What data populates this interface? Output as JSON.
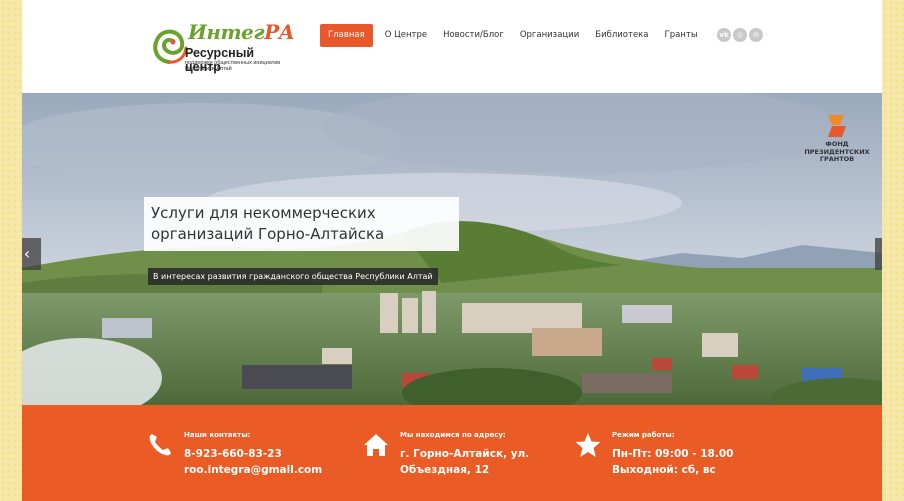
{
  "logo": {
    "script_part1": "Интег",
    "script_part2": "РА",
    "title": "Ресурсный центр",
    "subtitle": "поддержки общественных инициатив Республики Алтай"
  },
  "nav": {
    "items": [
      "Главная",
      "О Центре",
      "Новости/Блог",
      "Организации",
      "Библиотека",
      "Гранты"
    ]
  },
  "social": {
    "vk": "vk",
    "instagram": "◎",
    "email": "✉"
  },
  "hero": {
    "title": "Услуги для некоммерческих организаций Горно-Алтайска",
    "subtitle": "В интересах развития гражданского общества Республики Алтай",
    "grant_logo": "ФОНД ПРЕЗИДЕНТСКИХ ГРАНТОВ",
    "prev_arrow": "‹",
    "next_arrow": "›"
  },
  "footer": {
    "contacts": {
      "label": "Наши контакты:",
      "line1": "8-923-660-83-23",
      "line2": "roo.integra@gmail.com"
    },
    "address": {
      "label": "Мы находимся по адресу:",
      "line1": "г. Горно-Алтайск, ул.",
      "line2": "Объездная, 12"
    },
    "hours": {
      "label": "Режим работы:",
      "line1": "Пн-Пт: 09:00 - 18.00",
      "line2": "Выходной: сб, вс"
    }
  },
  "colors": {
    "accent": "#ea5b25",
    "logo_green": "#6aa22e"
  }
}
